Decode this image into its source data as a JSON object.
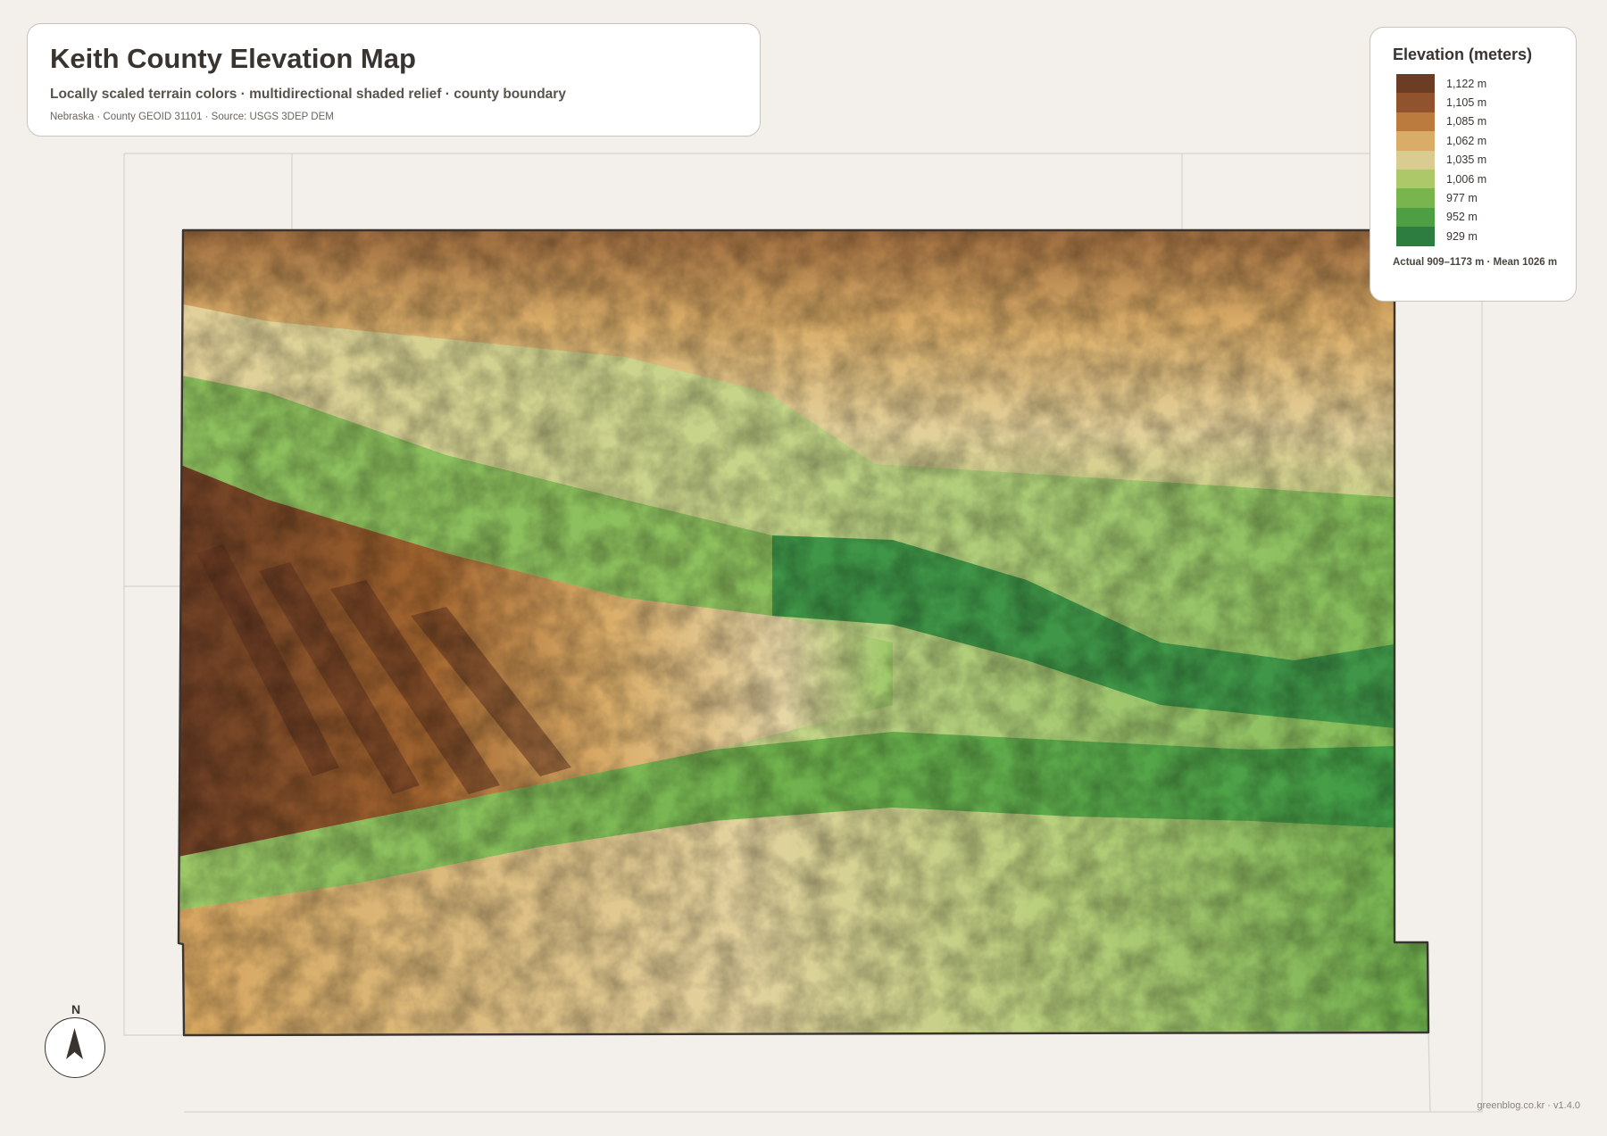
{
  "header": {
    "title": "Keith County Elevation Map",
    "subtitle": "Locally scaled terrain colors · multidirectional shaded relief · county boundary",
    "meta": "Nebraska · County GEOID 31101 · Source: USGS 3DEP DEM"
  },
  "legend": {
    "title": "Elevation (meters)",
    "items": [
      {
        "label": "1,122 m",
        "color": "#6b3d24"
      },
      {
        "label": "1,105 m",
        "color": "#91532d"
      },
      {
        "label": "1,085 m",
        "color": "#bb7a3e"
      },
      {
        "label": "1,062 m",
        "color": "#d9ac68"
      },
      {
        "label": "1,035 m",
        "color": "#d9cc90"
      },
      {
        "label": "1,006 m",
        "color": "#adc868"
      },
      {
        "label": "977 m",
        "color": "#78b54f"
      },
      {
        "label": "952 m",
        "color": "#4e9e43"
      },
      {
        "label": "929 m",
        "color": "#2e7d40"
      }
    ],
    "note": "Actual 909–1173 m · Mean 1026 m"
  },
  "compass": {
    "label": "N",
    "icon": "north-arrow-icon"
  },
  "footer": {
    "credit": "greenblog.co.kr · v1.4.0"
  },
  "colors": {
    "background": "#f3f0ec",
    "boundary": "#3a3430",
    "neighbor_lines": "#d6d1ca"
  }
}
